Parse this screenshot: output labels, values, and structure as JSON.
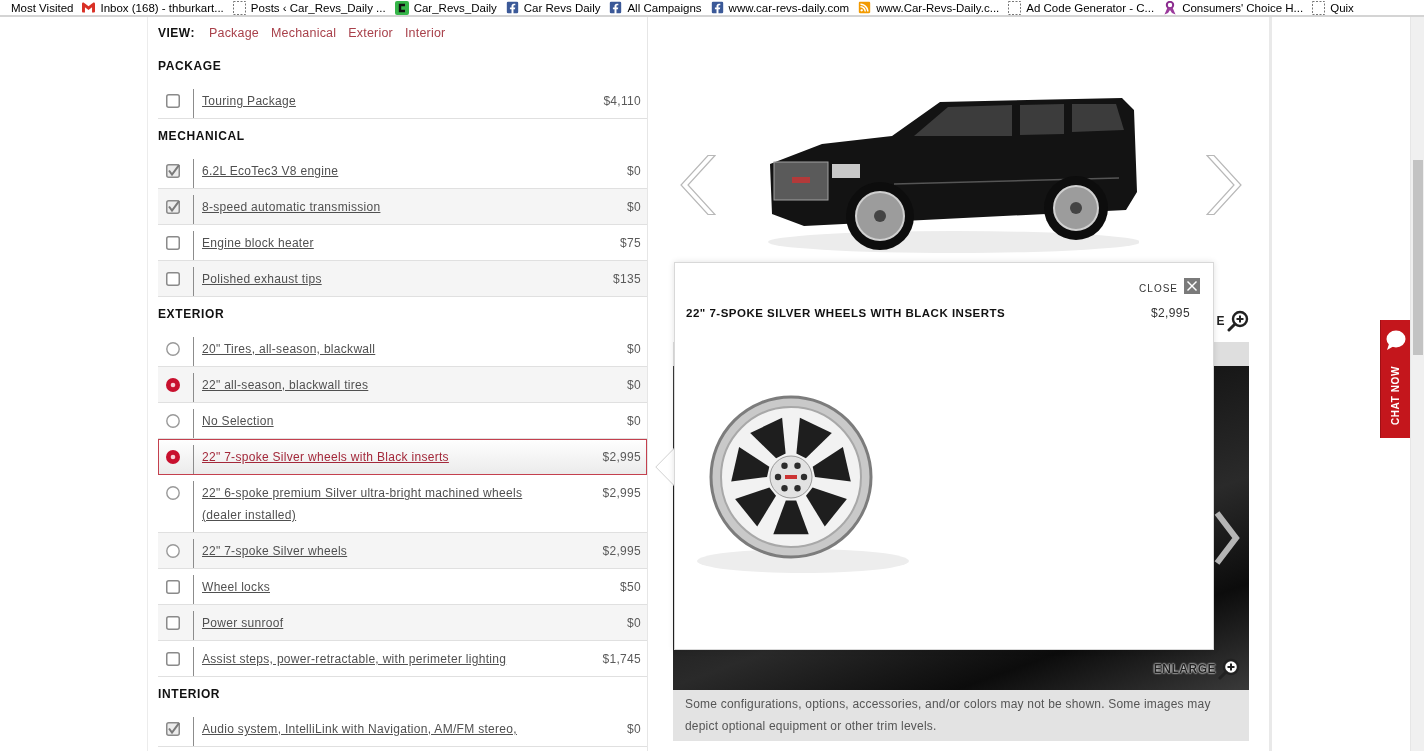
{
  "bookmarks": [
    {
      "kind": "none",
      "label": "Most Visited"
    },
    {
      "kind": "mail",
      "label": "Inbox (168) - thburkart..."
    },
    {
      "kind": "page",
      "label": "Posts ‹ Car_Revs_Daily ..."
    },
    {
      "kind": "app",
      "label": "Car_Revs_Daily"
    },
    {
      "kind": "facebook",
      "label": "Car Revs Daily"
    },
    {
      "kind": "facebook",
      "label": "All Campaigns"
    },
    {
      "kind": "facebook",
      "label": "www.car-revs-daily.com"
    },
    {
      "kind": "rss",
      "label": "www.Car-Revs-Daily.c..."
    },
    {
      "kind": "page",
      "label": "Ad Code Generator - C..."
    },
    {
      "kind": "ribbon",
      "label": "Consumers' Choice H..."
    },
    {
      "kind": "page",
      "label": "Quix"
    }
  ],
  "view_nav": {
    "label": "VIEW:",
    "links": [
      "Package",
      "Mechanical",
      "Exterior",
      "Interior"
    ]
  },
  "sections": [
    {
      "heading": "PACKAGE",
      "options": [
        {
          "kind": "checkbox",
          "label": "Touring Package",
          "price": "$4,110",
          "checked": false,
          "highlighted": false
        }
      ]
    },
    {
      "heading": "MECHANICAL",
      "options": [
        {
          "kind": "checkbox",
          "label": "6.2L EcoTec3 V8 engine",
          "price": "$0",
          "checked": true,
          "highlighted": false
        },
        {
          "kind": "checkbox",
          "label": "8-speed automatic transmission",
          "price": "$0",
          "checked": true,
          "highlighted": false
        },
        {
          "kind": "checkbox",
          "label": "Engine block heater",
          "price": "$75",
          "checked": false,
          "highlighted": false
        },
        {
          "kind": "checkbox",
          "label": "Polished exhaust tips",
          "price": "$135",
          "checked": false,
          "highlighted": false
        }
      ]
    },
    {
      "heading": "EXTERIOR",
      "options": [
        {
          "kind": "radio",
          "label": "20\" Tires, all-season, blackwall",
          "price": "$0",
          "selected": false,
          "highlighted": false
        },
        {
          "kind": "radio",
          "label": "22\" all-season, blackwall tires",
          "price": "$0",
          "selected": true,
          "highlighted": false
        },
        {
          "kind": "radio",
          "label": "No Selection",
          "price": "$0",
          "selected": false,
          "highlighted": false
        },
        {
          "kind": "radio",
          "label": "22\" 7-spoke Silver wheels with Black inserts",
          "price": "$2,995",
          "selected": true,
          "highlighted": true
        },
        {
          "kind": "radio",
          "label": "22\" 6-spoke premium Silver ultra-bright machined wheels (dealer installed)",
          "price": "$2,995",
          "selected": false,
          "highlighted": false
        },
        {
          "kind": "radio",
          "label": "22\" 7-spoke Silver wheels",
          "price": "$2,995",
          "selected": false,
          "highlighted": false
        },
        {
          "kind": "checkbox",
          "label": "Wheel locks",
          "price": "$50",
          "checked": false,
          "highlighted": false
        },
        {
          "kind": "checkbox",
          "label": "Power sunroof",
          "price": "$0",
          "checked": false,
          "highlighted": false
        },
        {
          "kind": "checkbox",
          "label": "Assist steps, power-retractable, with perimeter lighting",
          "price": "$1,745",
          "checked": false,
          "highlighted": false
        }
      ]
    },
    {
      "heading": "INTERIOR",
      "options": [
        {
          "kind": "checkbox",
          "label": "Audio system, IntelliLink with Navigation, AM/FM stereo,",
          "price": "$0",
          "checked": true,
          "highlighted": false
        }
      ]
    }
  ],
  "gallery": {
    "top_enlarge": "E",
    "bottom_enlarge": "ENLARGE",
    "disclaimer": "Some configurations, options, accessories, and/or colors may not be shown. Some images may depict optional equipment or other trim levels."
  },
  "popup": {
    "close_label": "CLOSE",
    "title": "22\" 7-SPOKE SILVER WHEELS WITH BLACK INSERTS",
    "price": "$2,995"
  },
  "chat": {
    "label": "CHAT NOW"
  }
}
